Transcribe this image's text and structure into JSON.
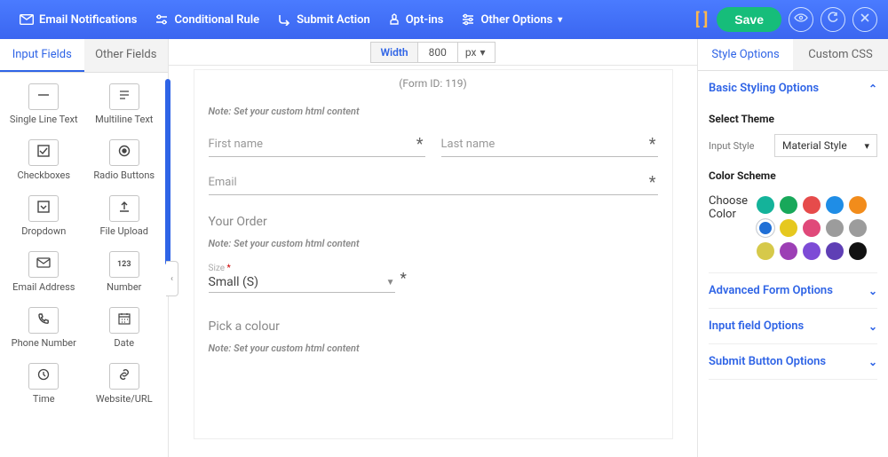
{
  "topbar": {
    "email_notifications": "Email Notifications",
    "conditional_rule": "Conditional Rule",
    "submit_action": "Submit Action",
    "opt_ins": "Opt-ins",
    "other_options": "Other Options",
    "save": "Save"
  },
  "left": {
    "tabs": {
      "input_fields": "Input Fields",
      "other_fields": "Other Fields"
    },
    "fields": [
      {
        "label": "Single Line Text"
      },
      {
        "label": "Multiline Text"
      },
      {
        "label": "Checkboxes"
      },
      {
        "label": "Radio Buttons"
      },
      {
        "label": "Dropdown"
      },
      {
        "label": "File Upload"
      },
      {
        "label": "Email Address"
      },
      {
        "label": "Number"
      },
      {
        "label": "Phone Number"
      },
      {
        "label": "Date"
      },
      {
        "label": "Time"
      },
      {
        "label": "Website/URL"
      }
    ]
  },
  "center": {
    "width_label": "Width",
    "width_value": "800",
    "width_unit": "px",
    "form_id": "(Form ID: 119)",
    "note1": "Note: Set your custom html content",
    "first_name": "First name",
    "last_name": "Last name",
    "email": "Email",
    "your_order": "Your Order",
    "note2": "Note: Set your custom html content",
    "size_label": "Size",
    "size_value": "Small (S)",
    "pick_colour": "Pick a colour",
    "note3": "Note: Set your custom html content"
  },
  "right": {
    "tabs": {
      "style_options": "Style Options",
      "custom_css": "Custom CSS"
    },
    "acc1_title": "Basic Styling Options",
    "select_theme": "Select Theme",
    "input_style_label": "Input Style",
    "input_style_value": "Material Style",
    "color_scheme": "Color Scheme",
    "choose_color": "Choose Color",
    "swatches": [
      "#14b39a",
      "#18a85a",
      "#e64b4b",
      "#1f8de6",
      "#f28c1b",
      "#1f6fd6",
      "#e6c81f",
      "#e0497a",
      "#9c9c9c",
      "#9c9c9c",
      "#d6c94a",
      "#9c3fb5",
      "#7d4bd6",
      "#5f3fb5",
      "#111"
    ],
    "selected_swatch_index": 5,
    "acc2_title": "Advanced Form Options",
    "acc3_title": "Input field Options",
    "acc4_title": "Submit Button Options"
  }
}
